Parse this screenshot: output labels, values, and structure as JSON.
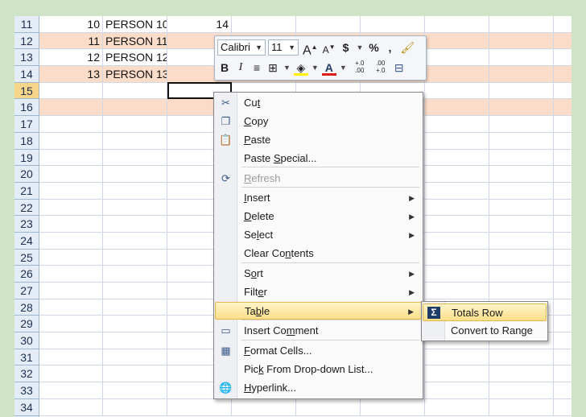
{
  "rows": [
    {
      "num": "11",
      "a": "10",
      "b": "PERSON 10",
      "c": "14",
      "band": false
    },
    {
      "num": "12",
      "a": "11",
      "b": "PERSON 11",
      "c": "",
      "band": true
    },
    {
      "num": "13",
      "a": "12",
      "b": "PERSON 12",
      "c": "",
      "band": false
    },
    {
      "num": "14",
      "a": "13",
      "b": "PERSON 13",
      "c": "",
      "band": true
    },
    {
      "num": "15",
      "a": "",
      "b": "",
      "c": "",
      "band": false
    },
    {
      "num": "16",
      "a": "",
      "b": "",
      "c": "",
      "band": true
    },
    {
      "num": "17"
    },
    {
      "num": "18"
    },
    {
      "num": "19"
    },
    {
      "num": "20"
    },
    {
      "num": "21"
    },
    {
      "num": "22"
    },
    {
      "num": "23"
    },
    {
      "num": "24"
    },
    {
      "num": "25"
    },
    {
      "num": "26"
    },
    {
      "num": "27"
    },
    {
      "num": "28"
    },
    {
      "num": "29"
    },
    {
      "num": "30"
    },
    {
      "num": "31"
    },
    {
      "num": "32"
    },
    {
      "num": "33"
    },
    {
      "num": "34"
    }
  ],
  "mini_toolbar": {
    "font": "Calibri",
    "size": "11",
    "grow_font": "A",
    "shrink_font": "A",
    "currency": "$",
    "percent": "%",
    "comma": ",",
    "bold": "B",
    "italic": "I",
    "font_color": "A",
    "increase_decimal": "+.0 .00",
    "decrease_decimal": ".00 +.0"
  },
  "menu": {
    "items": [
      {
        "label": "Cut",
        "icon": "scissors-icon",
        "ul": "t"
      },
      {
        "label": "Copy",
        "icon": "copy-icon",
        "ul": "C"
      },
      {
        "label": "Paste",
        "icon": "paste-icon",
        "ul": "P"
      },
      {
        "label": "Paste Special...",
        "icon": "",
        "ul": "S"
      },
      {
        "label": "Refresh",
        "icon": "refresh-icon",
        "ul": "R",
        "disabled": true
      },
      {
        "label": "Insert",
        "icon": "",
        "ul": "I",
        "submenu": true
      },
      {
        "label": "Delete",
        "icon": "",
        "ul": "D",
        "submenu": true
      },
      {
        "label": "Select",
        "icon": "",
        "ul": "l",
        "submenu": true
      },
      {
        "label": "Clear Contents",
        "icon": "",
        "ul": "n"
      },
      {
        "label": "Sort",
        "icon": "",
        "ul": "o",
        "submenu": true
      },
      {
        "label": "Filter",
        "icon": "",
        "ul": "e",
        "submenu": true
      },
      {
        "label": "Table",
        "icon": "",
        "ul": "b",
        "submenu": true,
        "highlighted": true
      },
      {
        "label": "Insert Comment",
        "icon": "comment-icon",
        "ul": "m"
      },
      {
        "label": "Format Cells...",
        "icon": "format-cells-icon",
        "ul": "F"
      },
      {
        "label": "Pick From Drop-down List...",
        "icon": "",
        "ul": "k"
      },
      {
        "label": "Hyperlink...",
        "icon": "hyperlink-icon",
        "ul": "H"
      }
    ]
  },
  "submenu": {
    "items": [
      {
        "label": "Totals Row",
        "icon": "sigma-icon",
        "highlighted": true
      },
      {
        "label": "Convert to Range",
        "icon": ""
      }
    ]
  }
}
